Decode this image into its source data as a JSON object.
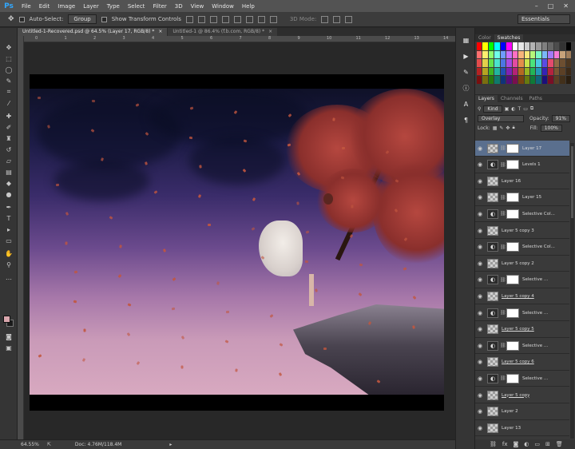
{
  "app": {
    "logo": "Ps"
  },
  "menu": [
    "File",
    "Edit",
    "Image",
    "Layer",
    "Type",
    "Select",
    "Filter",
    "3D",
    "View",
    "Window",
    "Help"
  ],
  "window_controls": [
    "–",
    "□",
    "✕"
  ],
  "options_bar": {
    "auto_select_label": "Auto-Select:",
    "auto_select_value": "Group",
    "show_transform_label": "Show Transform Controls",
    "mode_3d_label": "3D Mode:",
    "workspace_value": "Essentials"
  },
  "doc_tabs": [
    {
      "label": "Untitled-1-Recovered.psd @ 64.5% (Layer 17, RGB/8) *",
      "close": "×"
    },
    {
      "label": "Untitled-1 @ 86.4% (f.b.com, RGB/8) *",
      "close": "×"
    }
  ],
  "ruler_marks": [
    "0",
    "1",
    "2",
    "3",
    "4",
    "5",
    "6",
    "7",
    "8",
    "9",
    "10",
    "11",
    "12",
    "13",
    "14"
  ],
  "status": {
    "zoom": "64.55%",
    "doc": "Doc: 4.76M/118.4M"
  },
  "swatches_panel": {
    "tabs": [
      "Color",
      "Swatches"
    ],
    "colors": [
      "#ff0000",
      "#ffff00",
      "#00ff00",
      "#00ffff",
      "#0000ff",
      "#ff00ff",
      "#ffffff",
      "#e6e6e6",
      "#cccccc",
      "#b3b3b3",
      "#999999",
      "#808080",
      "#666666",
      "#4d4d4d",
      "#333333",
      "#000000",
      "#ff6f6f",
      "#fff06f",
      "#8fff6f",
      "#6fffe8",
      "#6f9bff",
      "#c66fff",
      "#ff6fc2",
      "#f7b37a",
      "#f7e77a",
      "#b6f77a",
      "#7af7c3",
      "#7ab8f7",
      "#a27af7",
      "#f77ad6",
      "#c7a27a",
      "#a07d5a",
      "#e34b4b",
      "#e3d14b",
      "#63e34b",
      "#4be3cb",
      "#4b76e3",
      "#a64be3",
      "#e34ba1",
      "#e38e4b",
      "#c9e34b",
      "#4be37a",
      "#4bc9e3",
      "#5b4be3",
      "#e34b6e",
      "#8f6a45",
      "#6d4f31",
      "#4d3720",
      "#b52222",
      "#b5a322",
      "#3fb522",
      "#22b59f",
      "#2250b5",
      "#7f22b5",
      "#b52276",
      "#b56822",
      "#98b522",
      "#22b556",
      "#2299b5",
      "#3522b5",
      "#b5223f",
      "#7a5633",
      "#5b4026",
      "#3d2a17",
      "#7a0f0f",
      "#7a6e0f",
      "#267a0f",
      "#0f7a6b",
      "#0f337a",
      "#550f7a",
      "#7a0f4f",
      "#7a430f",
      "#677a0f",
      "#0f7a37",
      "#0f667a",
      "#1c0f7a",
      "#7a0f26",
      "#5c4025",
      "#42301b",
      "#2a1e10"
    ]
  },
  "layers_panel": {
    "tabs": [
      "Layers",
      "Channels",
      "Paths"
    ],
    "kind": "Kind",
    "blend_mode": "Overlay",
    "opacity_label": "Opacity:",
    "opacity": "91%",
    "lock_label": "Lock:",
    "fill_label": "Fill:",
    "fill": "100%",
    "layers": [
      {
        "name": "Layer 17",
        "type": "pixel",
        "mask": true,
        "selected": true,
        "underline": false
      },
      {
        "name": "Levels 1",
        "type": "adjustment",
        "mask": true,
        "selected": false,
        "underline": false
      },
      {
        "name": "Layer 16",
        "type": "pixel",
        "mask": false,
        "selected": false,
        "underline": false
      },
      {
        "name": "Layer 15",
        "type": "pixel",
        "mask": true,
        "selected": false,
        "underline": false
      },
      {
        "name": "Selective Col...",
        "type": "adjustment",
        "mask": true,
        "selected": false,
        "underline": false
      },
      {
        "name": "Layer 5 copy 3",
        "type": "pixel",
        "mask": false,
        "selected": false,
        "underline": false
      },
      {
        "name": "Selective Col...",
        "type": "adjustment",
        "mask": true,
        "selected": false,
        "underline": false
      },
      {
        "name": "Layer 5 copy 2",
        "type": "pixel",
        "mask": false,
        "selected": false,
        "underline": false
      },
      {
        "name": "Selective ...",
        "type": "adjustment",
        "mask": true,
        "selected": false,
        "underline": false
      },
      {
        "name": "Layer 5 copy 4",
        "type": "pixel",
        "mask": false,
        "selected": false,
        "underline": true
      },
      {
        "name": "Selective ...",
        "type": "adjustment",
        "mask": true,
        "selected": false,
        "underline": false
      },
      {
        "name": "Layer 5 copy 5",
        "type": "pixel",
        "mask": false,
        "selected": false,
        "underline": true
      },
      {
        "name": "Selective ...",
        "type": "adjustment",
        "mask": true,
        "selected": false,
        "underline": false
      },
      {
        "name": "Layer 5 copy 6",
        "type": "pixel",
        "mask": false,
        "selected": false,
        "underline": true
      },
      {
        "name": "Selective ...",
        "type": "adjustment",
        "mask": true,
        "selected": false,
        "underline": false
      },
      {
        "name": "Layer 5 copy",
        "type": "pixel",
        "mask": false,
        "selected": false,
        "underline": true
      },
      {
        "name": "Layer 2",
        "type": "pixel",
        "mask": false,
        "selected": false,
        "underline": false
      },
      {
        "name": "Layer 13",
        "type": "pixel",
        "mask": false,
        "selected": false,
        "underline": false
      }
    ],
    "footer_icons": [
      "link-icon",
      "fx-icon",
      "mask-icon",
      "adjustment-icon",
      "folder-icon",
      "new-layer-icon",
      "trash-icon"
    ]
  }
}
